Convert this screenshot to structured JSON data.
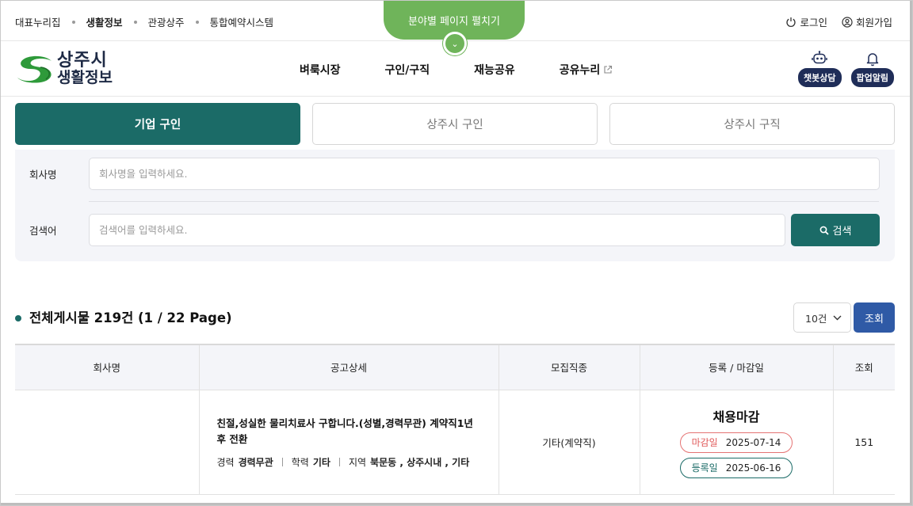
{
  "util": {
    "links": [
      "대표누리집",
      "생활정보",
      "관광상주",
      "통합예약시스템"
    ],
    "active_link": "생활정보",
    "unfold_label": "분야별 페이지 펼치기",
    "login": "로그인",
    "signup": "회원가입"
  },
  "header": {
    "logo_line1": "상주시",
    "logo_line2": "생활정보",
    "nav": [
      "벼룩시장",
      "구인/구직",
      "재능공유",
      "공유누리"
    ],
    "chatbot": "챗봇상담",
    "popup": "팝업알림"
  },
  "tabs": [
    {
      "label": "기업 구인",
      "active": true
    },
    {
      "label": "상주시 구인",
      "active": false
    },
    {
      "label": "상주시 구직",
      "active": false
    }
  ],
  "search": {
    "company_label": "회사명",
    "company_placeholder": "회사명을 입력하세요.",
    "keyword_label": "검색어",
    "keyword_placeholder": "검색어를 입력하세요.",
    "button": "검색"
  },
  "list": {
    "summary": "전체게시물 219건 (1 / 22 Page)",
    "page_size": "10건",
    "view_button": "조회"
  },
  "table": {
    "headers": [
      "회사명",
      "공고상세",
      "모집직종",
      "등록 / 마감일",
      "조회"
    ],
    "rows": [
      {
        "company": "",
        "title": "친절,성실한 물리치료사 구합니다.(성별,경력무관) 계약직1년 후 전환",
        "career_label": "경력",
        "career": "경력무관",
        "edu_label": "학력",
        "edu": "기타",
        "region_label": "지역",
        "region": "북문동 , 상주시내 , 기타",
        "job": "기타(계약직)",
        "status": "채용마감",
        "deadline_label": "마감일",
        "deadline": "2025-07-14",
        "reg_label": "등록일",
        "reg": "2025-06-16",
        "views": "151"
      }
    ]
  },
  "colors": {
    "primary": "#1b6b67",
    "accent_green": "#6fb45a",
    "navy": "#1f2d58",
    "blue_button": "#2f5aa6",
    "deadline_red": "#e05a5a"
  }
}
